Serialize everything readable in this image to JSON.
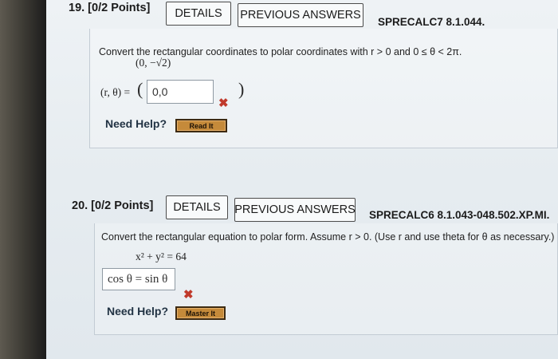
{
  "q19": {
    "title": "19.  [0/2 Points]",
    "details_label": "DETAILS",
    "prev_label": "PREVIOUS ANSWERS",
    "code": "SPRECALC7 8.1.044.",
    "instruction": "Convert the rectangular coordinates to polar coordinates with r > 0 and 0 ≤ θ < 2π.",
    "point": "(0, −√2)",
    "answer_label": "(r, θ) =",
    "answer_value": "0,0",
    "result_icon": "red-x-icon",
    "help_label": "Need Help?",
    "help_button": "Read It"
  },
  "q20": {
    "title": "20.  [0/2 Points]",
    "details_label": "DETAILS",
    "prev_label": "PREVIOUS ANSWERS",
    "code": "SPRECALC6 8.1.043-048.502.XP.MI.",
    "instruction": "Convert the rectangular equation to polar form. Assume r > 0. (Use r and use theta for θ as necessary.)",
    "equation": "x² + y² = 64",
    "answer_value": "cos θ = sin θ",
    "result_icon": "red-x-icon",
    "help_label": "Need Help?",
    "help_button": "Master It"
  },
  "colors": {
    "wrong": "#c0392b",
    "help_button": "#c58a3a"
  }
}
